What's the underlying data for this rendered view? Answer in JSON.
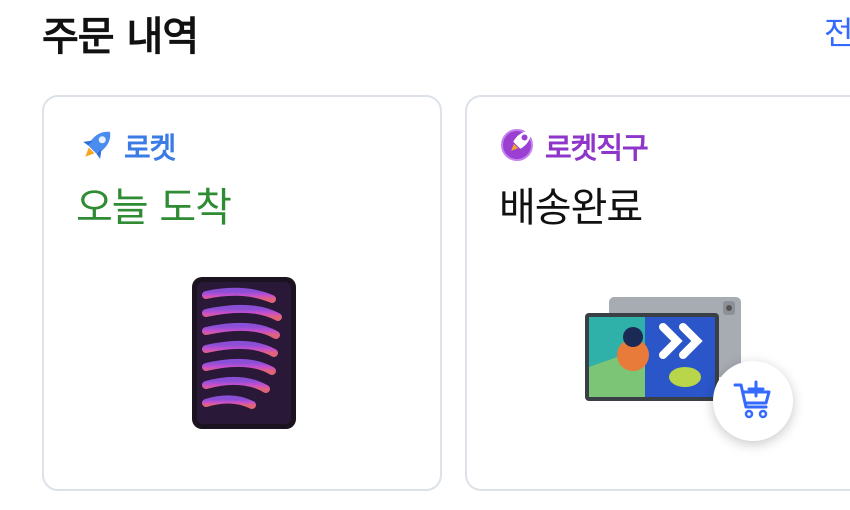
{
  "header": {
    "title": "주문 내역",
    "view_all": "전"
  },
  "orders": [
    {
      "badge_icon": "rocket-icon",
      "badge": "로켓",
      "status": "오늘 도착",
      "status_color": "#2f8b34",
      "product_icon": "ipad-mini-purple"
    },
    {
      "badge_icon": "rocket-direct-icon",
      "badge": "로켓직구",
      "status": "배송완료",
      "status_color": "#111111",
      "product_icon": "tablet-gray"
    }
  ],
  "cart_button": {
    "icon": "cart-add-icon"
  },
  "colors": {
    "accent": "#346aff",
    "rocket_blue": "#3a7be6",
    "direct_purple": "#8e36c9",
    "border": "#dde2e8"
  }
}
